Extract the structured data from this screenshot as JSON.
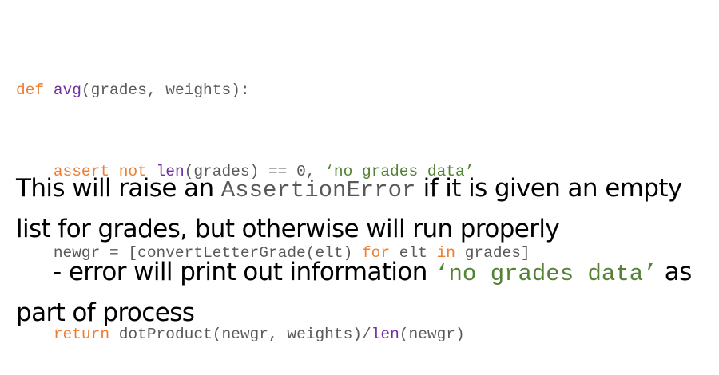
{
  "code": {
    "line1": {
      "kw_def": "def",
      "sp1": " ",
      "fn_avg": "avg",
      "rest": "(grades, weights):"
    },
    "line2": {
      "indent": "    ",
      "kw_assert": "assert",
      "sp1": " ",
      "kw_not": "not",
      "sp2": " ",
      "fn_len": "len",
      "mid": "(grades) == 0, ",
      "str": "‘no grades data’"
    },
    "line3": {
      "indent": "    ",
      "pre": "newgr = [convertLetterGrade(elt) ",
      "kw_for": "for",
      "mid": " elt ",
      "kw_in": "in",
      "post": " grades]"
    },
    "line4": {
      "indent": "    ",
      "kw_return": "return",
      "mid": " dotProduct(newgr, weights)/",
      "fn_len": "len",
      "post": "(newgr)"
    }
  },
  "explanation": {
    "para1": {
      "before": "This will raise an ",
      "code": "AssertionError",
      "after": " if it is given an empty list for grades, but otherwise will run properly"
    },
    "para2": {
      "before": "- error will print out information ",
      "code": "‘no grades data’",
      "after": " as part of process"
    }
  },
  "colors": {
    "keyword": "#ed7d31",
    "builtin_function": "#7030a0",
    "string": "#548235",
    "code_text": "#595959",
    "body_text": "#000000"
  }
}
